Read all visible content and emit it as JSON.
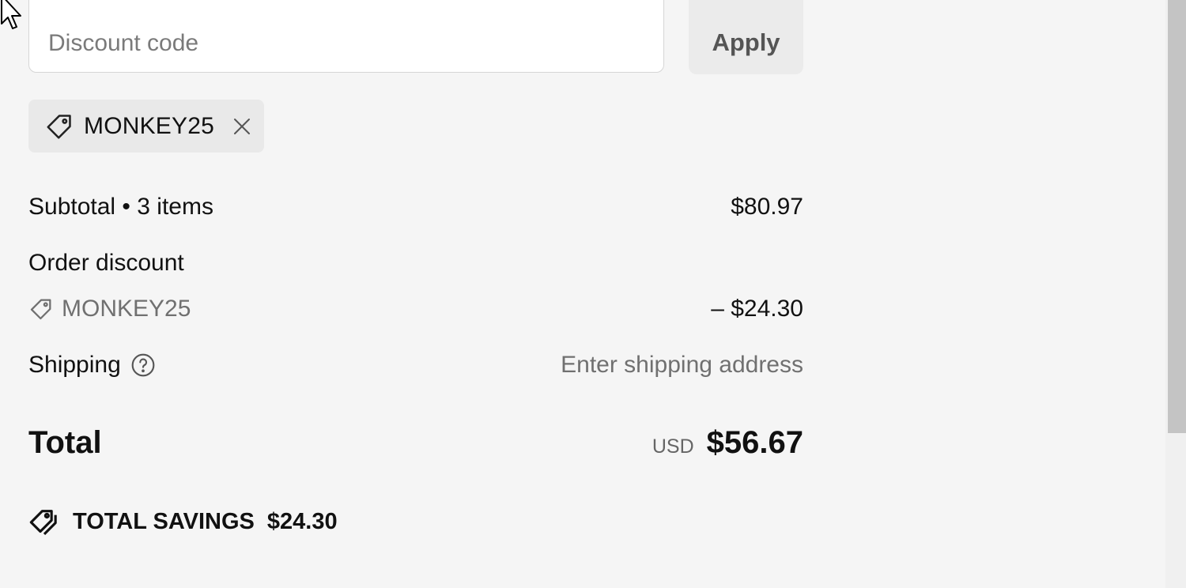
{
  "discount": {
    "placeholder": "Discount code",
    "value": "",
    "apply_label": "Apply",
    "applied_code": "MONKEY25"
  },
  "summary": {
    "subtotal_label": "Subtotal • 3 items",
    "subtotal_value": "$80.97",
    "order_discount_label": "Order discount",
    "discount_code": "MONKEY25",
    "discount_value": "– $24.30",
    "shipping_label": "Shipping",
    "shipping_value": "Enter shipping address",
    "total_label": "Total",
    "currency": "USD",
    "total_value": "$56.67",
    "savings_label": "TOTAL SAVINGS",
    "savings_value": "$24.30"
  },
  "icons": {
    "tag": "tag-icon",
    "remove": "close-icon",
    "help": "question-circle-icon",
    "savings": "double-tag-icon",
    "cursor": "mouse-cursor-icon"
  },
  "colors": {
    "background": "#f5f5f5",
    "muted_text": "#707070",
    "chip_background": "#e9e9e9",
    "button_background": "#ebebeb"
  }
}
